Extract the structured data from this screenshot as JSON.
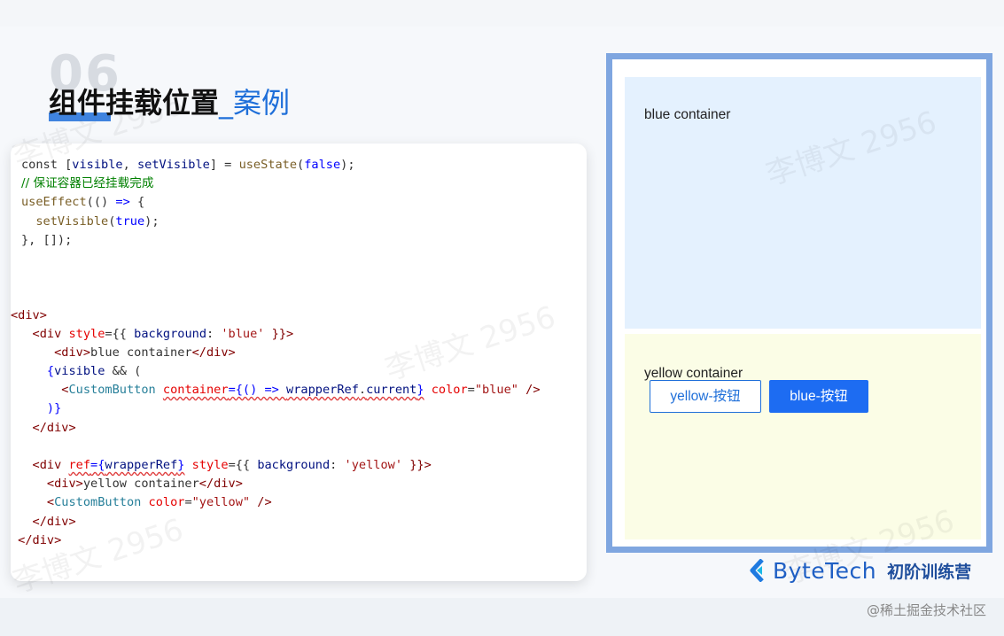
{
  "slide": {
    "section_number": "06",
    "title_main": "组件挂载位置",
    "title_separator": "_",
    "title_accent": "案例",
    "watermark_text": "李博文 2956"
  },
  "code": {
    "lines": [
      [
        {
          "t": "const ",
          "c": "kw"
        },
        {
          "t": "[",
          "c": "kw"
        },
        {
          "t": "visible",
          "c": "var"
        },
        {
          "t": ", ",
          "c": "kw"
        },
        {
          "t": "setVisible",
          "c": "var"
        },
        {
          "t": "] = ",
          "c": "kw"
        },
        {
          "t": "useState",
          "c": "fn"
        },
        {
          "t": "(",
          "c": "kw"
        },
        {
          "t": "false",
          "c": "num"
        },
        {
          "t": ");",
          "c": "kw"
        }
      ],
      [
        {
          "t": "// 保证容器已经挂载完成",
          "c": "cmt"
        }
      ],
      [
        {
          "t": "useEffect",
          "c": "fn"
        },
        {
          "t": "(() ",
          "c": "kw"
        },
        {
          "t": "=>",
          "c": "num"
        },
        {
          "t": " {",
          "c": "kw"
        }
      ],
      [
        {
          "t": "  setVisible",
          "c": "fn"
        },
        {
          "t": "(",
          "c": "kw"
        },
        {
          "t": "true",
          "c": "num"
        },
        {
          "t": ");",
          "c": "kw"
        }
      ],
      [
        {
          "t": "}, []);",
          "c": "kw"
        }
      ],
      [],
      [],
      [],
      [
        {
          "t": "<div>",
          "c": "tag"
        }
      ],
      [
        {
          "t": "   <div ",
          "c": "tag"
        },
        {
          "t": "style",
          "c": "attr"
        },
        {
          "t": "={{ ",
          "c": "kw"
        },
        {
          "t": "background",
          "c": "var"
        },
        {
          "t": ": ",
          "c": "kw"
        },
        {
          "t": "'blue'",
          "c": "str"
        },
        {
          "t": " }}>",
          "c": "tag"
        }
      ],
      [
        {
          "t": "      <div>",
          "c": "tag"
        },
        {
          "t": "blue container",
          "c": "kw"
        },
        {
          "t": "</div>",
          "c": "tag"
        }
      ],
      [
        {
          "t": "     {",
          "c": "num"
        },
        {
          "t": "visible",
          "c": "var"
        },
        {
          "t": " && (",
          "c": "kw"
        }
      ],
      [
        {
          "t": "       <",
          "c": "tag"
        },
        {
          "t": "CustomButton",
          "c": "comp"
        },
        {
          "t": " ",
          "c": "kw"
        },
        {
          "t": "container",
          "c": "attr",
          "e": 1
        },
        {
          "t": "={() => ",
          "c": "num",
          "e": 1
        },
        {
          "t": "wrapperRef",
          "c": "var",
          "e": 1
        },
        {
          "t": ".",
          "c": "kw",
          "e": 1
        },
        {
          "t": "current",
          "c": "var",
          "e": 1
        },
        {
          "t": "}",
          "c": "num",
          "e": 1
        },
        {
          "t": " ",
          "c": "kw"
        },
        {
          "t": "color",
          "c": "attr"
        },
        {
          "t": "=",
          "c": "kw"
        },
        {
          "t": "\"blue\"",
          "c": "str"
        },
        {
          "t": " />",
          "c": "tag"
        }
      ],
      [
        {
          "t": "     )}",
          "c": "num"
        }
      ],
      [
        {
          "t": "   </div>",
          "c": "tag"
        }
      ],
      [],
      [
        {
          "t": "   <div ",
          "c": "tag"
        },
        {
          "t": "ref",
          "c": "attr",
          "e": 1
        },
        {
          "t": "={",
          "c": "num",
          "e": 1
        },
        {
          "t": "wrapperRef",
          "c": "var",
          "e": 1
        },
        {
          "t": "}",
          "c": "num",
          "e": 1
        },
        {
          "t": " ",
          "c": "kw"
        },
        {
          "t": "style",
          "c": "attr"
        },
        {
          "t": "={{ ",
          "c": "kw"
        },
        {
          "t": "background",
          "c": "var"
        },
        {
          "t": ": ",
          "c": "kw"
        },
        {
          "t": "'yellow'",
          "c": "str"
        },
        {
          "t": " }}>",
          "c": "tag"
        }
      ],
      [
        {
          "t": "     <div>",
          "c": "tag"
        },
        {
          "t": "yellow container",
          "c": "kw"
        },
        {
          "t": "</div>",
          "c": "tag"
        }
      ],
      [
        {
          "t": "     <",
          "c": "tag"
        },
        {
          "t": "CustomButton",
          "c": "comp"
        },
        {
          "t": " ",
          "c": "kw"
        },
        {
          "t": "color",
          "c": "attr"
        },
        {
          "t": "=",
          "c": "kw"
        },
        {
          "t": "\"yellow\"",
          "c": "str"
        },
        {
          "t": " />",
          "c": "tag"
        }
      ],
      [
        {
          "t": "   </div>",
          "c": "tag"
        }
      ],
      [
        {
          "t": " </div>",
          "c": "tag"
        }
      ]
    ],
    "indents": [
      2,
      2,
      2,
      2,
      2,
      0,
      0,
      0,
      0,
      0,
      0,
      0,
      0,
      0,
      0,
      0,
      0,
      0,
      0,
      0,
      0
    ]
  },
  "preview": {
    "blue_container_text": "blue container",
    "yellow_container_text": "yellow container",
    "yellow_button_label": "yellow-按钮",
    "blue_button_label": "blue-按钮",
    "colors": {
      "frame": "#7fa6e0",
      "blue_bg": "#e4f1fe",
      "yellow_bg": "#fbfde6",
      "primary": "#1d6cf2"
    }
  },
  "brand": {
    "name": "ByteTech",
    "subtitle": "初阶训练营",
    "logo_icon": "bytetech-logo-icon"
  },
  "footer": {
    "credit": "@稀土掘金技术社区"
  }
}
